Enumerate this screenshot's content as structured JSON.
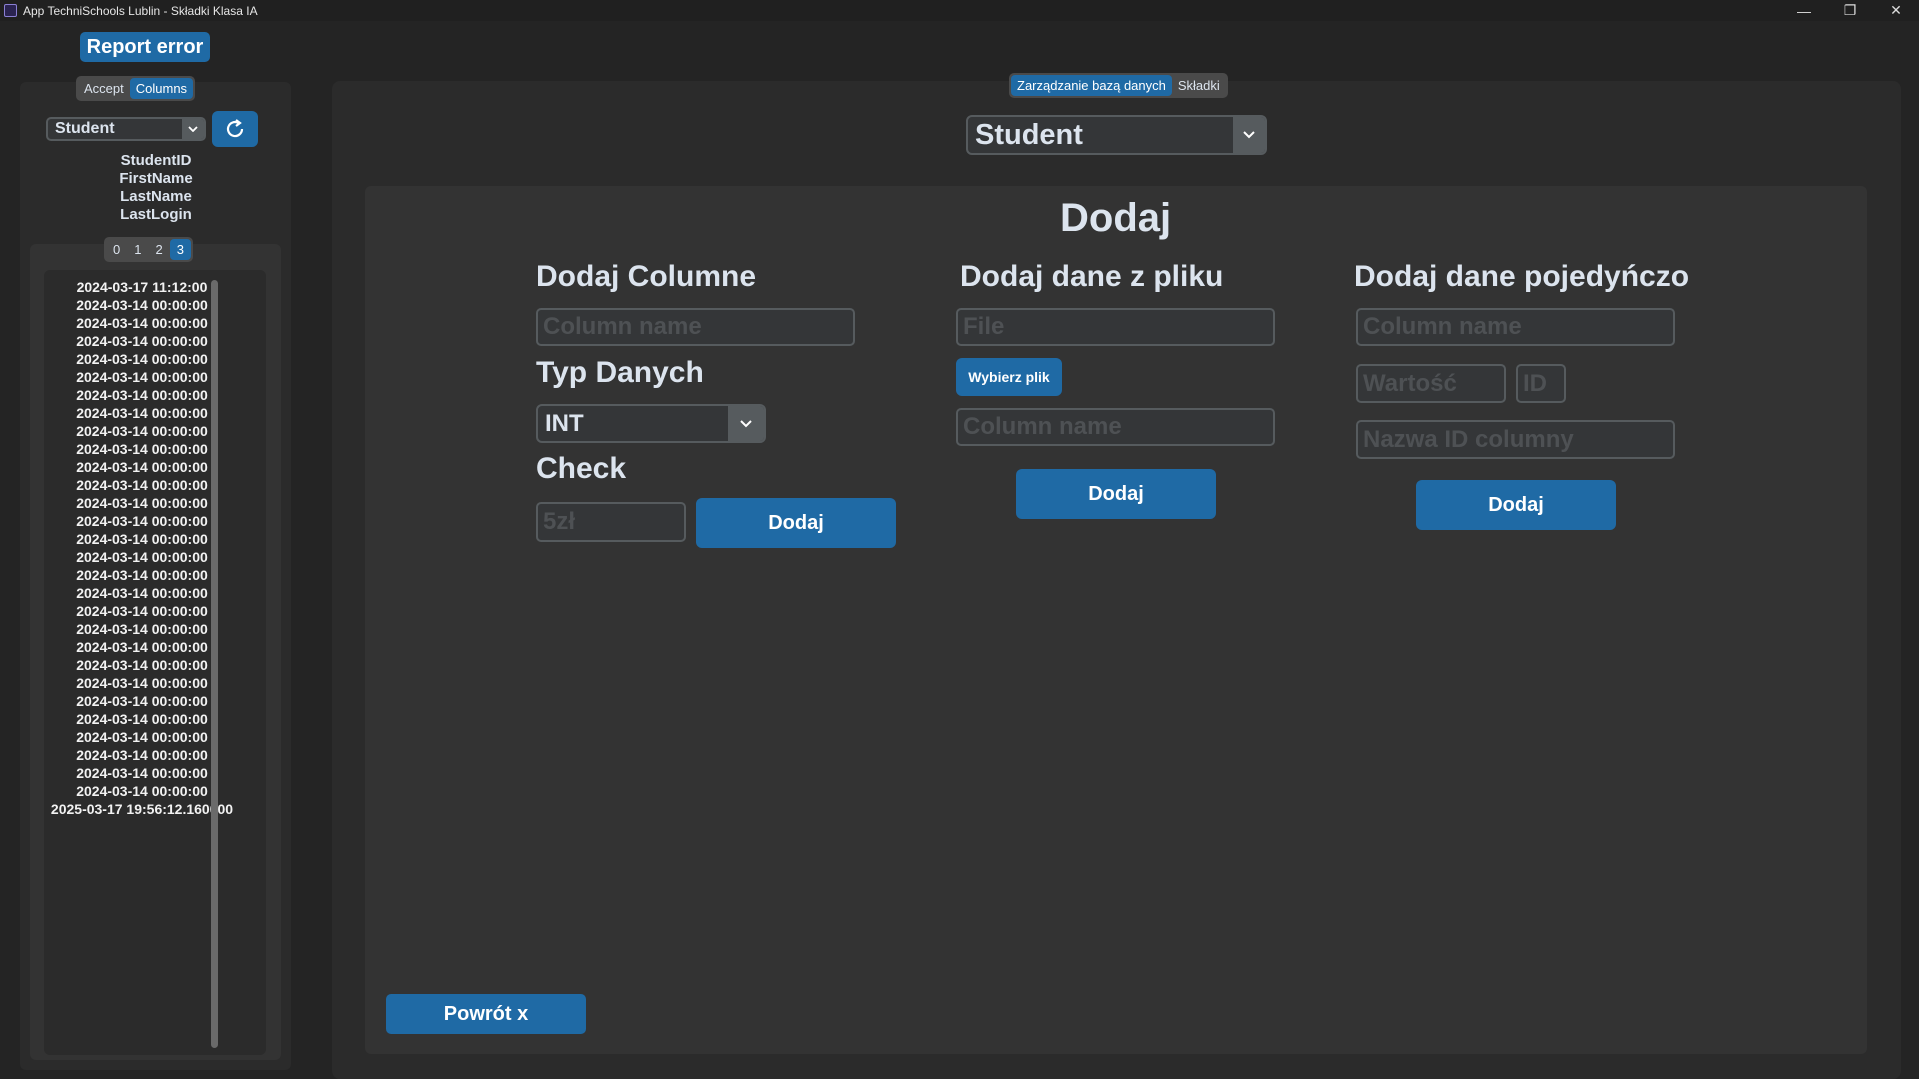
{
  "window": {
    "title": "App TechniSchools Lublin - Składki Klasa IA",
    "minimize": "—",
    "maximize": "❐",
    "close": "✕"
  },
  "report_error": "Report error",
  "left": {
    "tabs": [
      {
        "label": "Accept",
        "active": false
      },
      {
        "label": "Columns",
        "active": true
      }
    ],
    "table_select": "Student",
    "refresh_icon": "↻",
    "columns": [
      "StudentID",
      "FirstName",
      "LastName",
      "LastLogin"
    ],
    "pages": [
      {
        "label": "0",
        "active": false
      },
      {
        "label": "1",
        "active": false
      },
      {
        "label": "2",
        "active": false
      },
      {
        "label": "3",
        "active": true
      }
    ],
    "values": [
      "2024-03-17 11:12:00",
      "2024-03-14 00:00:00",
      "2024-03-14 00:00:00",
      "2024-03-14 00:00:00",
      "2024-03-14 00:00:00",
      "2024-03-14 00:00:00",
      "2024-03-14 00:00:00",
      "2024-03-14 00:00:00",
      "2024-03-14 00:00:00",
      "2024-03-14 00:00:00",
      "2024-03-14 00:00:00",
      "2024-03-14 00:00:00",
      "2024-03-14 00:00:00",
      "2024-03-14 00:00:00",
      "2024-03-14 00:00:00",
      "2024-03-14 00:00:00",
      "2024-03-14 00:00:00",
      "2024-03-14 00:00:00",
      "2024-03-14 00:00:00",
      "2024-03-14 00:00:00",
      "2024-03-14 00:00:00",
      "2024-03-14 00:00:00",
      "2024-03-14 00:00:00",
      "2024-03-14 00:00:00",
      "2024-03-14 00:00:00",
      "2024-03-14 00:00:00",
      "2024-03-14 00:00:00",
      "2024-03-14 00:00:00",
      "2024-03-14 00:00:00",
      "2025-03-17 19:56:12.160000"
    ]
  },
  "main": {
    "tabs": [
      {
        "label": "Zarządzanie bazą danych",
        "active": true
      },
      {
        "label": "Składki",
        "active": false
      }
    ],
    "table_select": "Student",
    "heading": "Dodaj",
    "col1": {
      "title": "Dodaj Columne",
      "column_name_placeholder": "Column name",
      "type_label": "Typ Danych",
      "type_value": "INT",
      "check_label": "Check",
      "check_placeholder": "5zł",
      "add_button": "Dodaj"
    },
    "col2": {
      "title": "Dodaj dane z pliku",
      "file_placeholder": "File",
      "choose_file_button": "Wybierz plik",
      "column_name_placeholder": "Column name",
      "add_button": "Dodaj"
    },
    "col3": {
      "title": "Dodaj dane pojedyńczo",
      "column_name_placeholder": "Column name",
      "value_placeholder": "Wartość",
      "id_placeholder": "ID",
      "id_column_placeholder": "Nazwa ID columny",
      "add_button": "Dodaj"
    },
    "back_button": "Powrót x"
  },
  "colors": {
    "accent": "#1f6aa5",
    "background": "#242424",
    "panel": "#2b2b2b",
    "inner_panel": "#333333"
  }
}
